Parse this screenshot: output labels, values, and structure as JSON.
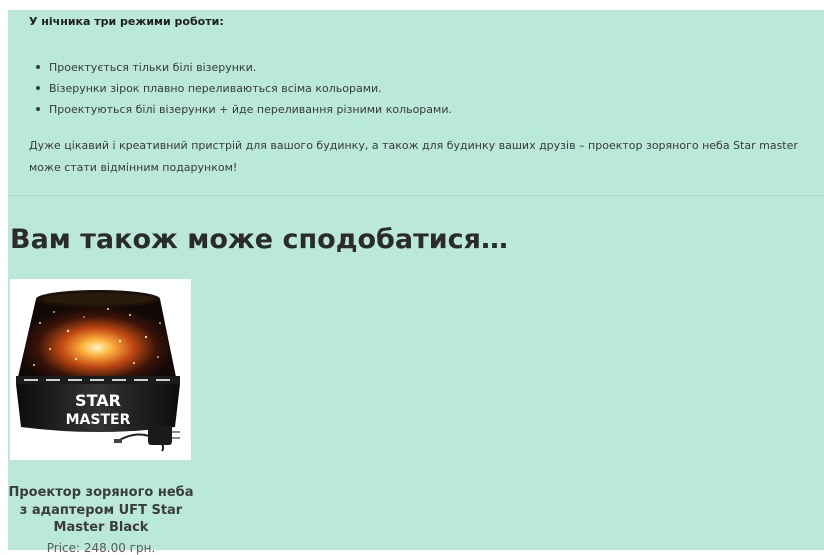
{
  "description": {
    "modes_title": "У нічника три режими роботи:",
    "modes": [
      "Проектується тільки білі візерунки.",
      "Візерунки зірок плавно переливаються всіма кольорами.",
      "Проектуються білі візерунки + йде переливання різними кольорами."
    ],
    "paragraph": "Дуже цікавий і креативний пристрій для вашого будинку, а також для будинку ваших друзів – проектор зоряного неба Star master може стати відмінним подарунком!"
  },
  "related": {
    "heading": "Вам також може сподобатися…",
    "products": [
      {
        "image_text_line1": "STAR",
        "image_text_line2": "MASTER",
        "title": "Проектор зоряного неба з адаптером UFT Star Master Black",
        "price": "Price:  248.00 грн."
      }
    ]
  },
  "colors": {
    "background": "#bae8db",
    "text": "#3a3a3a",
    "heading": "#2b2b2b"
  }
}
